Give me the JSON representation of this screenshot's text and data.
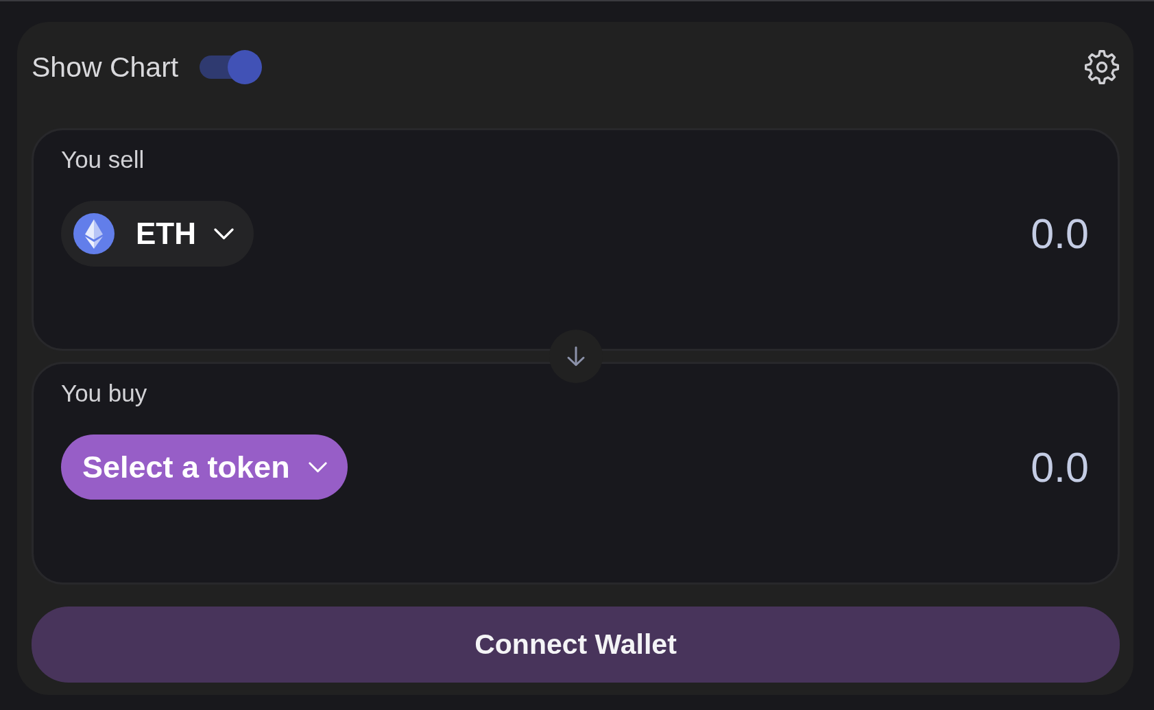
{
  "header": {
    "show_chart": {
      "label": "Show Chart",
      "on": true
    }
  },
  "panels": [
    {
      "label": "You sell",
      "token": {
        "kind": "token",
        "text": "ETH"
      },
      "amount": {
        "placeholder": "0.0"
      }
    },
    {
      "label": "You buy",
      "token": {
        "kind": "select",
        "text": "Select a token"
      },
      "amount": {
        "placeholder": "0.0"
      }
    }
  ],
  "connect_button": {
    "label": "Connect Wallet"
  }
}
